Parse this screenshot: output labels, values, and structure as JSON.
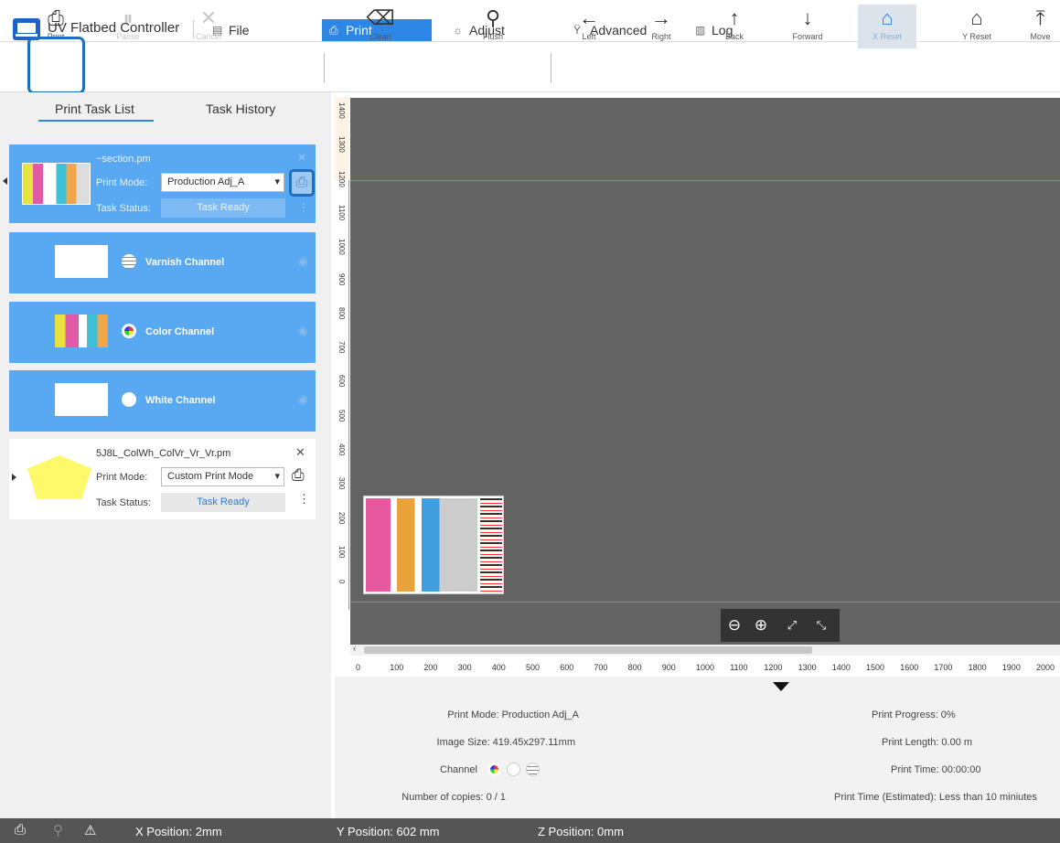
{
  "app": {
    "title": "UV Flatbed Controller"
  },
  "menu": {
    "file": "File",
    "print": "Print",
    "adjust": "Adjust",
    "advanced": "Advanced",
    "log": "Log"
  },
  "toolbar": {
    "print": "Print",
    "pause": "Pause",
    "cancel": "Cancel",
    "clean": "Clean",
    "flush": "Flush",
    "left": "Left",
    "right": "Right",
    "back": "Back",
    "forward": "Forward",
    "x_reset": "X Reset",
    "y_reset": "Y Reset",
    "move": "Move"
  },
  "tabs": {
    "task_list": "Print Task List",
    "task_history": "Task History"
  },
  "tasks": [
    {
      "name": "~section.pm",
      "print_mode_label": "Print Mode:",
      "print_mode": "Production Adj_A",
      "status_label": "Task Status:",
      "status": "Task Ready"
    },
    {
      "name": "5J8L_ColWh_ColVr_Vr_Vr.pm",
      "print_mode_label": "Print Mode:",
      "print_mode": "Custom Print Mode",
      "status_label": "Task Status:",
      "status": "Task Ready"
    }
  ],
  "channels": [
    {
      "label": "Varnish Channel"
    },
    {
      "label": "Color Channel"
    },
    {
      "label": "White Channel"
    }
  ],
  "ruler": {
    "vertical": [
      "1400",
      "1300",
      "1200",
      "1100",
      "1000",
      "900",
      "800",
      "700",
      "600",
      "500",
      "400",
      "300",
      "200",
      "100",
      "0"
    ],
    "horizontal": [
      "0",
      "100",
      "200",
      "300",
      "400",
      "500",
      "600",
      "700",
      "800",
      "900",
      "1000",
      "1100",
      "1200",
      "1300",
      "1400",
      "1500",
      "1600",
      "1700",
      "1800",
      "1900",
      "2000"
    ]
  },
  "info": {
    "print_mode": "Print Mode: Production Adj_A",
    "image_size": "Image Size: 419.45x297.11mm",
    "channel": "Channel",
    "copies": "Number of copies: 0 / 1",
    "progress": "Print Progress: 0%",
    "length": "Print Length: 0.00 m",
    "time": "Print Time: 00:00:00",
    "estimated": "Print Time (Estimated): Less than 10 miniutes"
  },
  "status": {
    "x": "X Position: 2mm",
    "y": "Y Position: 602 mm",
    "z": "Z Position: 0mm"
  },
  "colors": {
    "accent": "#2b86e6",
    "task_bg": "#58a8f2",
    "work_area": "#636363",
    "highlight": "#1f6fbf"
  }
}
